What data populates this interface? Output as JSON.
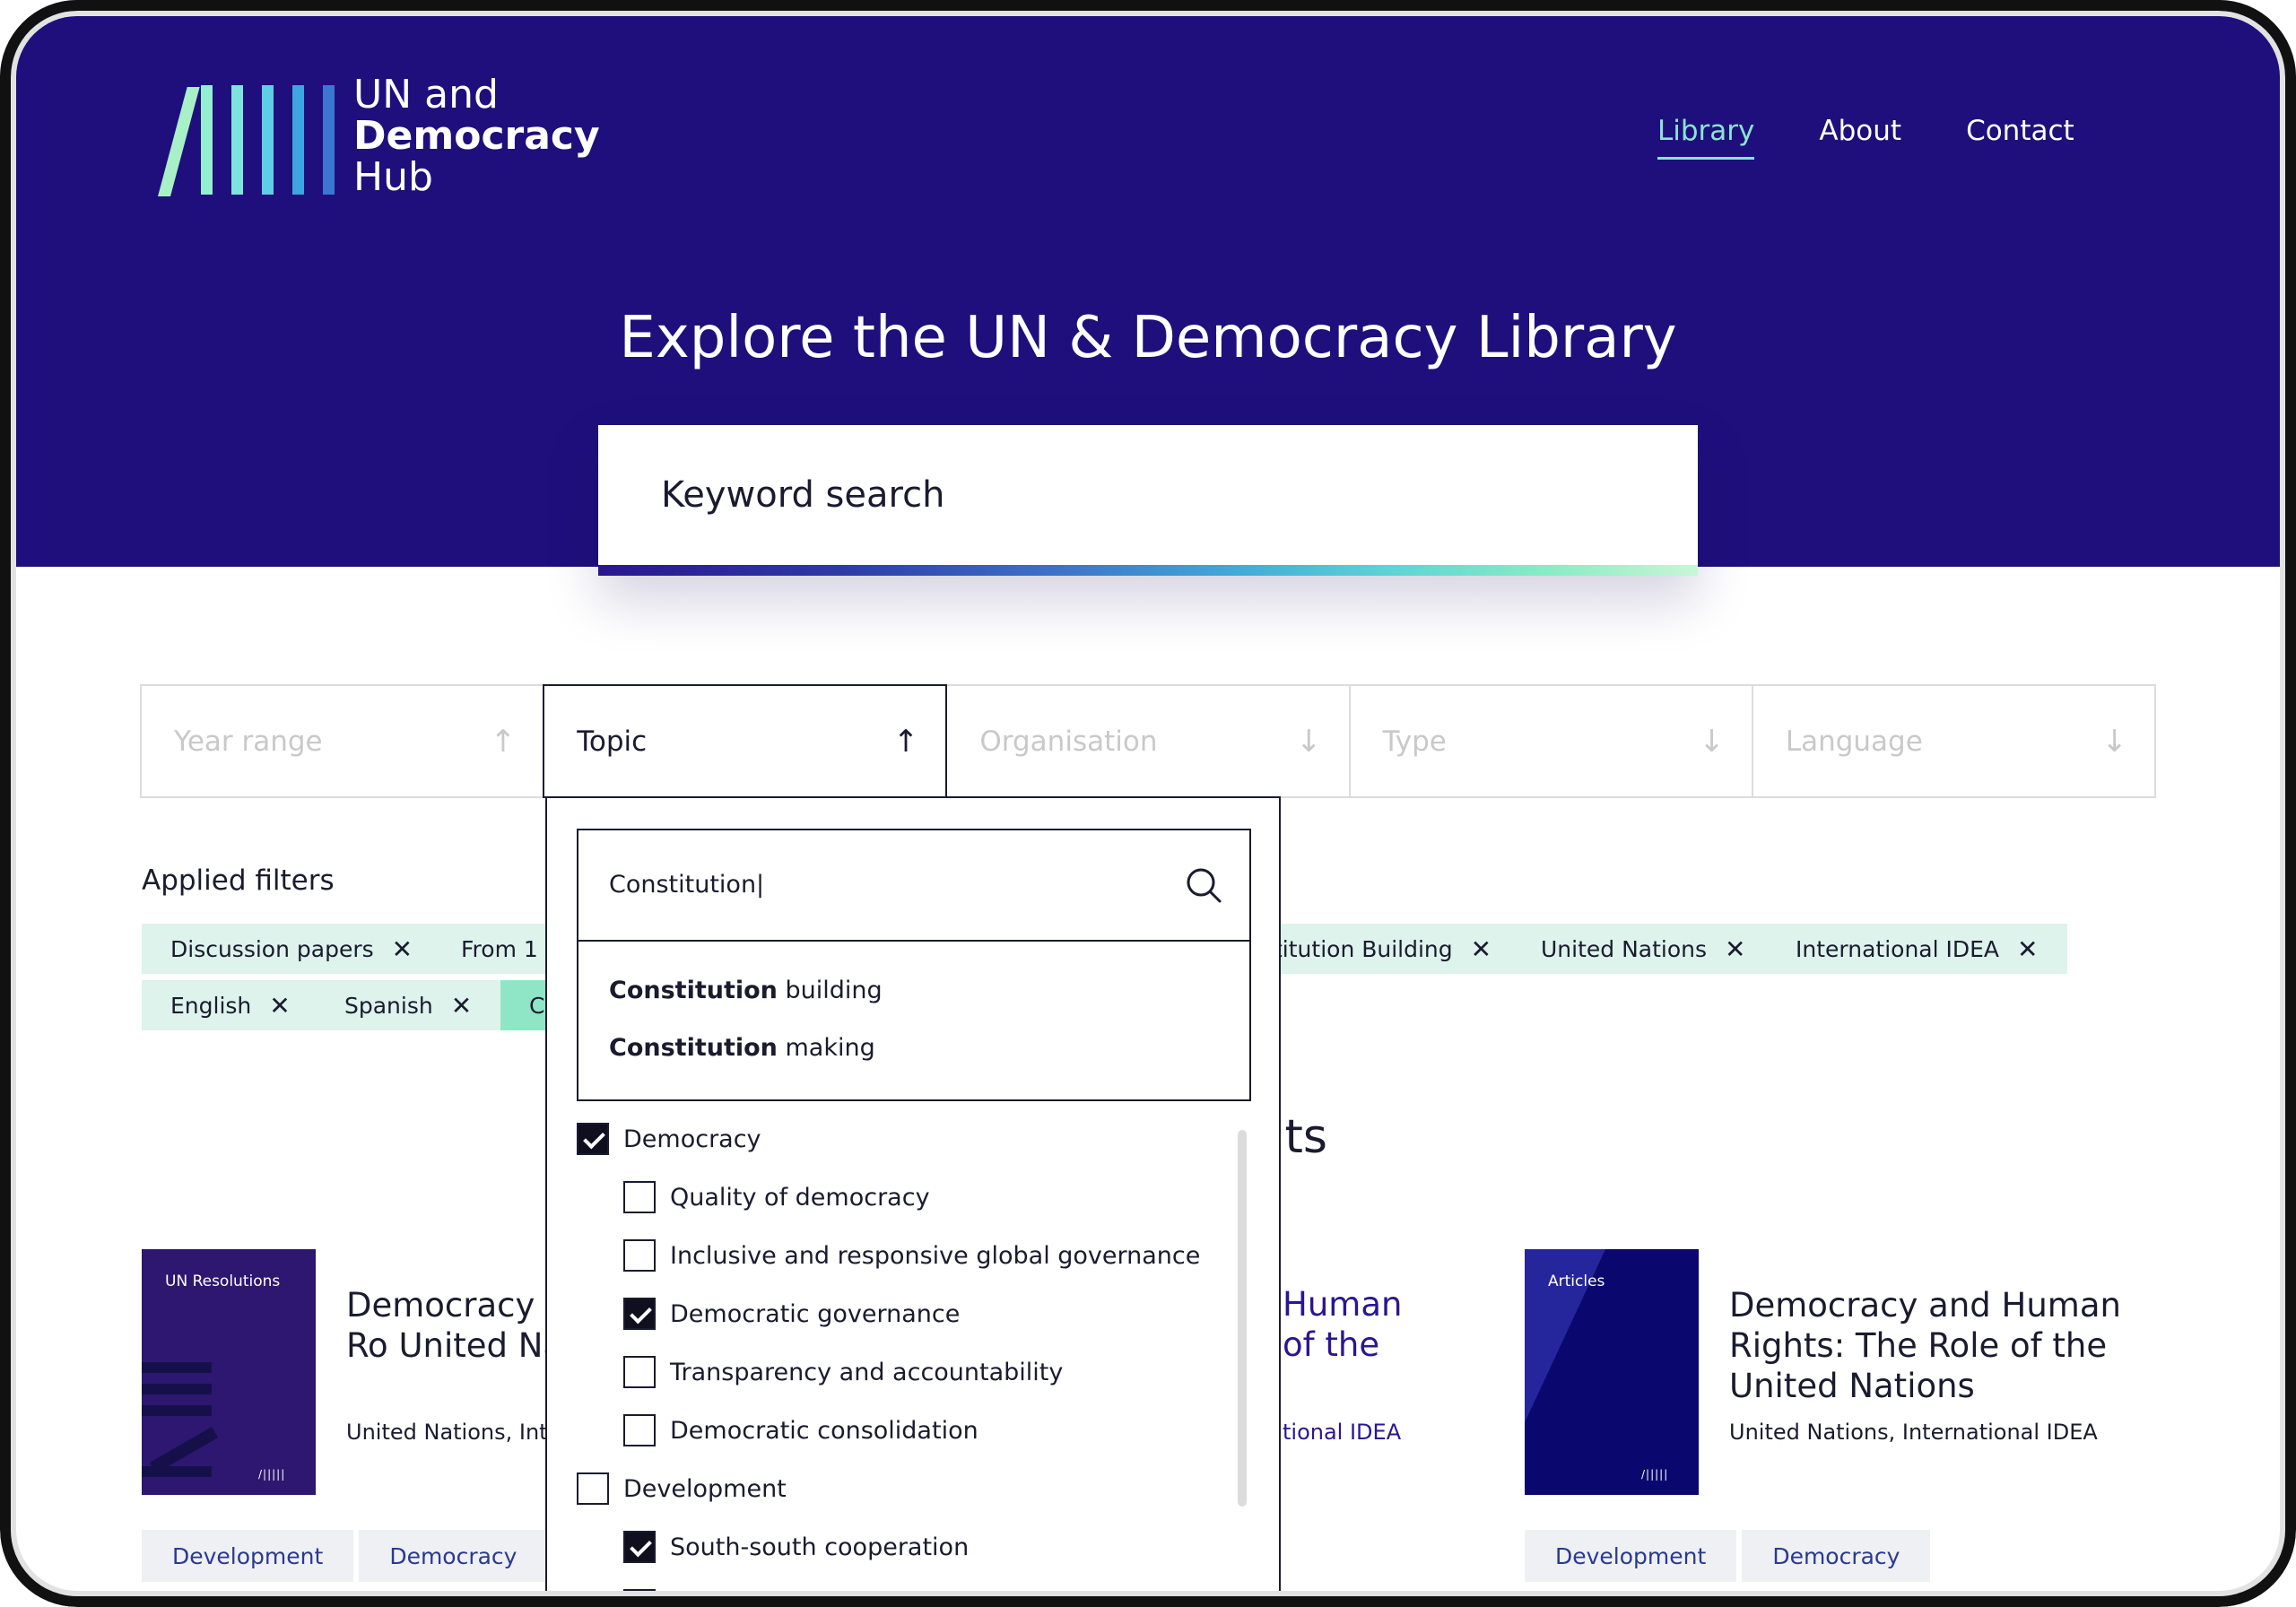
{
  "header": {
    "logo": {
      "line1": "UN and",
      "line2": "Democracy",
      "line3": "Hub"
    },
    "nav": [
      {
        "label": "Library",
        "active": true
      },
      {
        "label": "About",
        "active": false
      },
      {
        "label": "Contact",
        "active": false
      }
    ]
  },
  "hero": {
    "title": "Explore the UN & Democracy Library",
    "search_placeholder": "Keyword search"
  },
  "filters": [
    {
      "label": "Year range",
      "arrow": "↑"
    },
    {
      "label": "Topic",
      "arrow": "↑"
    },
    {
      "label": "Organisation",
      "arrow": "↓"
    },
    {
      "label": "Type",
      "arrow": "↓"
    },
    {
      "label": "Language",
      "arrow": "↓"
    }
  ],
  "applied": {
    "title": "Applied filters",
    "chips": [
      {
        "label": "Discussion papers"
      },
      {
        "label": "From 1"
      },
      {
        "label": "titution Building"
      },
      {
        "label": "United Nations"
      },
      {
        "label": "International IDEA"
      },
      {
        "label": "English"
      },
      {
        "label": "Spanish"
      },
      {
        "label": "C"
      }
    ]
  },
  "results": {
    "title_partial": "lts",
    "cards": [
      {
        "cover_label": "UN Resolutions",
        "title": "Democracy a Rights: The Ro United Nation",
        "meta": "United Nations, Inte",
        "tags": [
          "Development",
          "Democracy"
        ]
      },
      {
        "title_partial_1": "Human",
        "title_partial_2": "of the",
        "meta_partial": "tional IDEA"
      },
      {
        "cover_label": "Articles",
        "title": "Democracy and Human Rights: The Role of the United Nations",
        "meta": "United Nations, International IDEA",
        "tags": [
          "Development",
          "Democracy"
        ]
      }
    ]
  },
  "topic_dropdown": {
    "search_value": "Constitution|",
    "suggestions": [
      {
        "bold": "Constitution",
        "rest": " building"
      },
      {
        "bold": "Constitution",
        "rest": " making"
      }
    ],
    "tree": [
      {
        "label": "Democracy",
        "checked": true,
        "level": 0
      },
      {
        "label": "Quality of democracy",
        "checked": false,
        "level": 1
      },
      {
        "label": "Inclusive and responsive global governance",
        "checked": false,
        "level": 1
      },
      {
        "label": "Democratic governance",
        "checked": true,
        "level": 1
      },
      {
        "label": "Transparency and accountability",
        "checked": false,
        "level": 1
      },
      {
        "label": "Democratic consolidation",
        "checked": false,
        "level": 1
      },
      {
        "label": "Development",
        "checked": false,
        "level": 0
      },
      {
        "label": "South-south cooperation",
        "checked": true,
        "level": 1
      }
    ]
  },
  "colors": {
    "hero_bg": "#1f0f7c",
    "nav_active": "#8ce3d3",
    "chip_bg": "#ddf3ec",
    "chip_accent": "#8fe6c7",
    "tag_bg": "#eef0f4"
  }
}
